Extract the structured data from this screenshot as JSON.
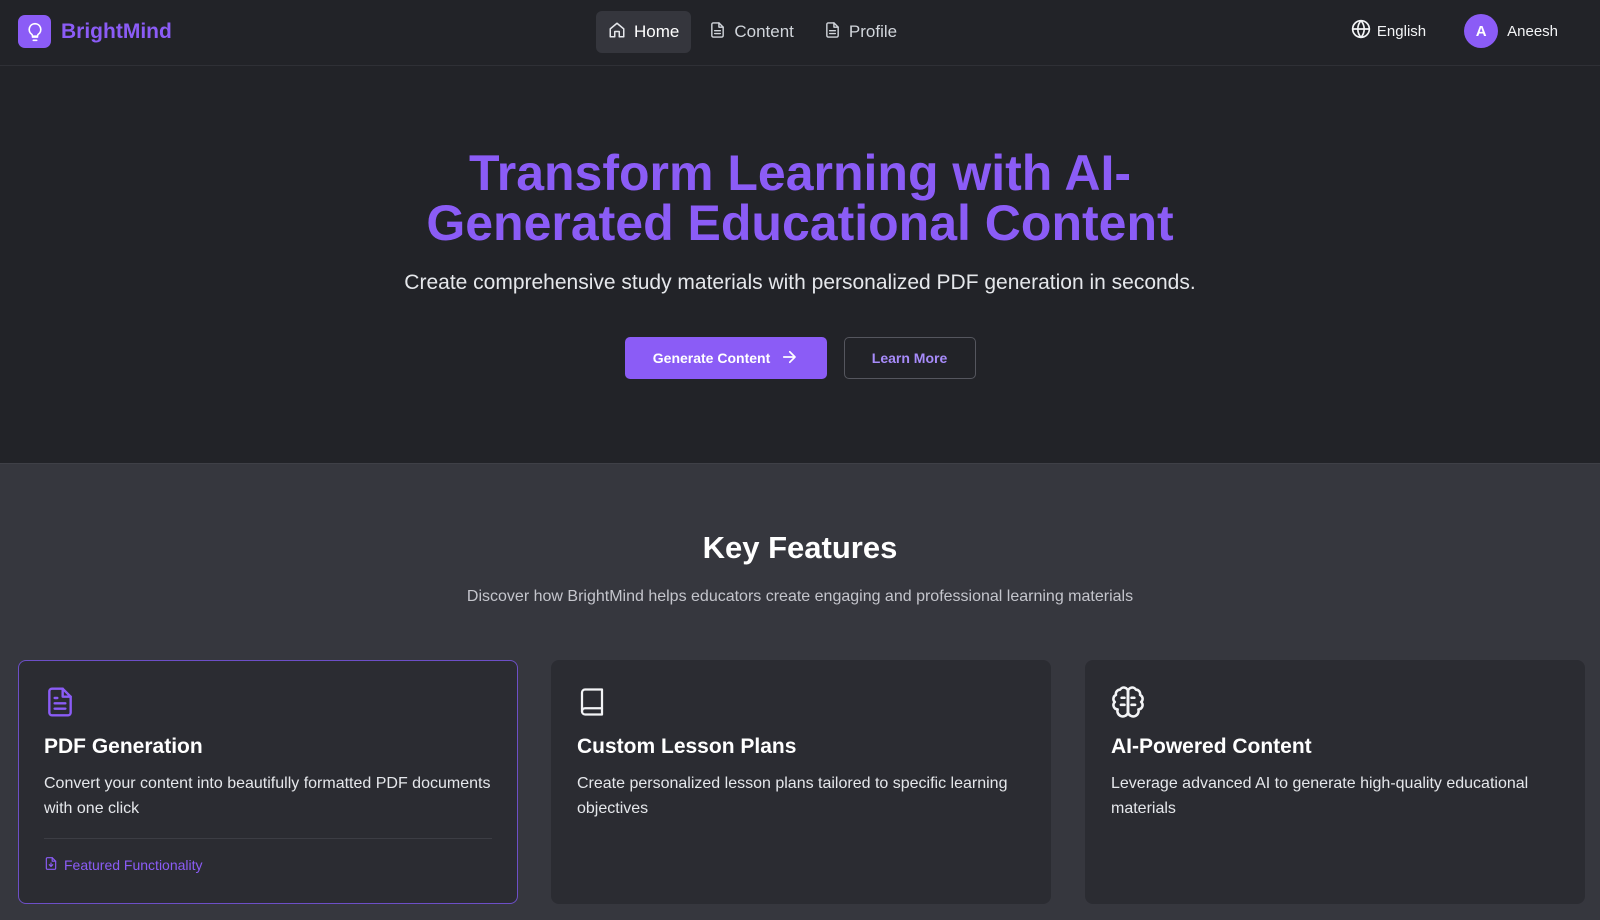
{
  "brand": {
    "name": "BrightMind",
    "accent": "#8b5cf6",
    "logo_icon": "lightbulb-icon"
  },
  "nav": {
    "items": [
      {
        "label": "Home",
        "icon": "home-icon",
        "active": true
      },
      {
        "label": "Content",
        "icon": "document-icon",
        "active": false
      },
      {
        "label": "Profile",
        "icon": "document-icon",
        "active": false
      }
    ],
    "language": {
      "label": "English",
      "icon": "globe-icon"
    },
    "user": {
      "initial": "A",
      "name": "Aneesh"
    }
  },
  "hero": {
    "title": "Transform Learning with AI-Generated Educational Content",
    "subtitle": "Create comprehensive study materials with personalized PDF generation in seconds.",
    "primary_button": "Generate Content",
    "secondary_button": "Learn More"
  },
  "features": {
    "title": "Key Features",
    "subtitle": "Discover how BrightMind helps educators create engaging and professional learning materials",
    "cards": [
      {
        "title": "PDF Generation",
        "description": "Convert your content into beautifully formatted PDF documents with one click",
        "icon": "file-text-icon",
        "tag": "Featured Functionality"
      },
      {
        "title": "Custom Lesson Plans",
        "description": "Create personalized lesson plans tailored to specific learning objectives",
        "icon": "book-icon"
      },
      {
        "title": "AI-Powered Content",
        "description": "Leverage advanced AI to generate high-quality educational materials",
        "icon": "brain-icon"
      }
    ]
  }
}
